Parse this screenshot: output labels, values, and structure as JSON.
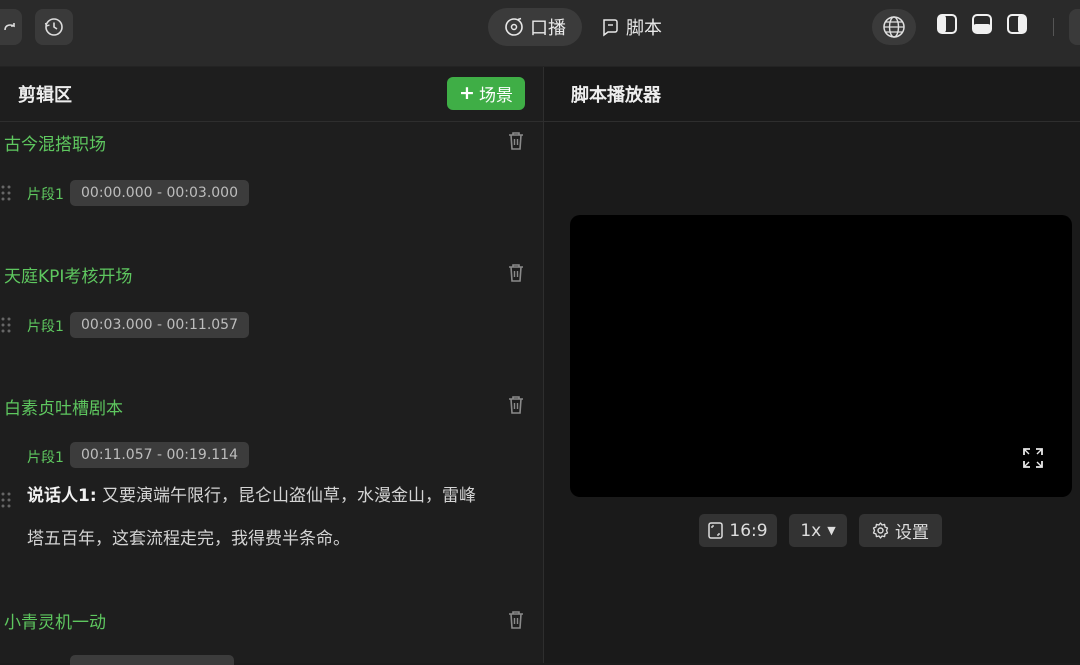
{
  "toolbar": {
    "modes": [
      {
        "label": "口播",
        "icon": "mic-bubble-icon",
        "active": true
      },
      {
        "label": "脚本",
        "icon": "script-bubble-icon",
        "active": false
      }
    ]
  },
  "editor": {
    "title": "剪辑区",
    "add_scene_label": "场景",
    "scenes": [
      {
        "title": "古今混搭职场",
        "segment_label": "片段1",
        "time_range": "00:00.000 - 00:03.000"
      },
      {
        "title": "天庭KPI考核开场",
        "segment_label": "片段1",
        "time_range": "00:03.000 - 00:11.057"
      },
      {
        "title": "白素贞吐槽剧本",
        "segment_label": "片段1",
        "time_range": "00:11.057 - 00:19.114",
        "speaker": "说话人1:",
        "line1": "又要演端午限行，昆仑山盗仙草，水漫金山，雷峰",
        "line2": "塔五百年，这套流程走完，我得费半条命。"
      },
      {
        "title": "小青灵机一动"
      }
    ]
  },
  "player": {
    "title": "脚本播放器",
    "aspect_label": "16:9",
    "speed_label": "1x",
    "settings_label": "设置"
  },
  "colors": {
    "accent": "#3fae46",
    "accent_text": "#5ec75f",
    "bg": "#1c1c1c",
    "topbar": "#2a2a2a"
  }
}
